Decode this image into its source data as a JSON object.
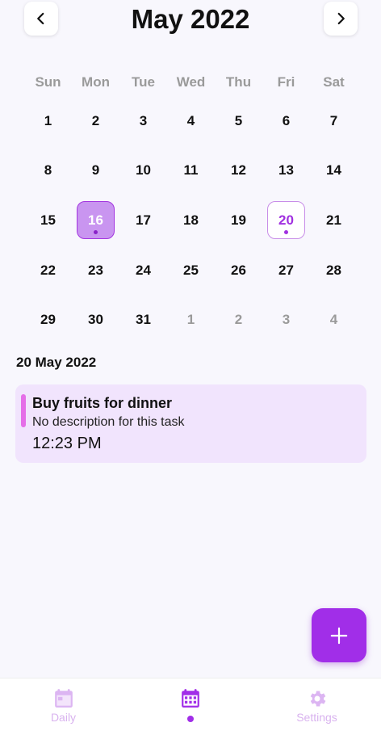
{
  "header": {
    "title": "May 2022",
    "prev_icon": "chevron-left-icon",
    "next_icon": "chevron-right-icon"
  },
  "calendar": {
    "weekdays": [
      "Sun",
      "Mon",
      "Tue",
      "Wed",
      "Thu",
      "Fri",
      "Sat"
    ],
    "days": [
      {
        "label": "1"
      },
      {
        "label": "2"
      },
      {
        "label": "3"
      },
      {
        "label": "4"
      },
      {
        "label": "5"
      },
      {
        "label": "6"
      },
      {
        "label": "7"
      },
      {
        "label": "8"
      },
      {
        "label": "9"
      },
      {
        "label": "10"
      },
      {
        "label": "11"
      },
      {
        "label": "12"
      },
      {
        "label": "13"
      },
      {
        "label": "14"
      },
      {
        "label": "15"
      },
      {
        "label": "16",
        "state": "selected",
        "has_event": true
      },
      {
        "label": "17"
      },
      {
        "label": "18"
      },
      {
        "label": "19"
      },
      {
        "label": "20",
        "state": "marked",
        "has_event": true
      },
      {
        "label": "21"
      },
      {
        "label": "22"
      },
      {
        "label": "23"
      },
      {
        "label": "24"
      },
      {
        "label": "25"
      },
      {
        "label": "26"
      },
      {
        "label": "27"
      },
      {
        "label": "28"
      },
      {
        "label": "29"
      },
      {
        "label": "30"
      },
      {
        "label": "31"
      },
      {
        "label": "1",
        "state": "other"
      },
      {
        "label": "2",
        "state": "other"
      },
      {
        "label": "3",
        "state": "other"
      },
      {
        "label": "4",
        "state": "other"
      }
    ]
  },
  "tasks_section": {
    "date_heading": "20 May 2022",
    "tasks": [
      {
        "title": "Buy fruits for dinner",
        "description": "No description for this task",
        "time": "12:23 PM",
        "accent_color": "#e56ee8"
      }
    ]
  },
  "fab": {
    "icon": "plus-icon"
  },
  "bottom_nav": {
    "items": [
      {
        "label": "Daily",
        "icon": "calendar-day-icon"
      },
      {
        "label": "",
        "icon": "calendar-month-icon",
        "active": true
      },
      {
        "label": "Settings",
        "icon": "gear-icon"
      }
    ]
  },
  "colors": {
    "accent": "#a12ee8",
    "accent_light": "#f1e4fd",
    "inactive_nav": "#d9b3ef",
    "background": "#f8f7fd"
  }
}
